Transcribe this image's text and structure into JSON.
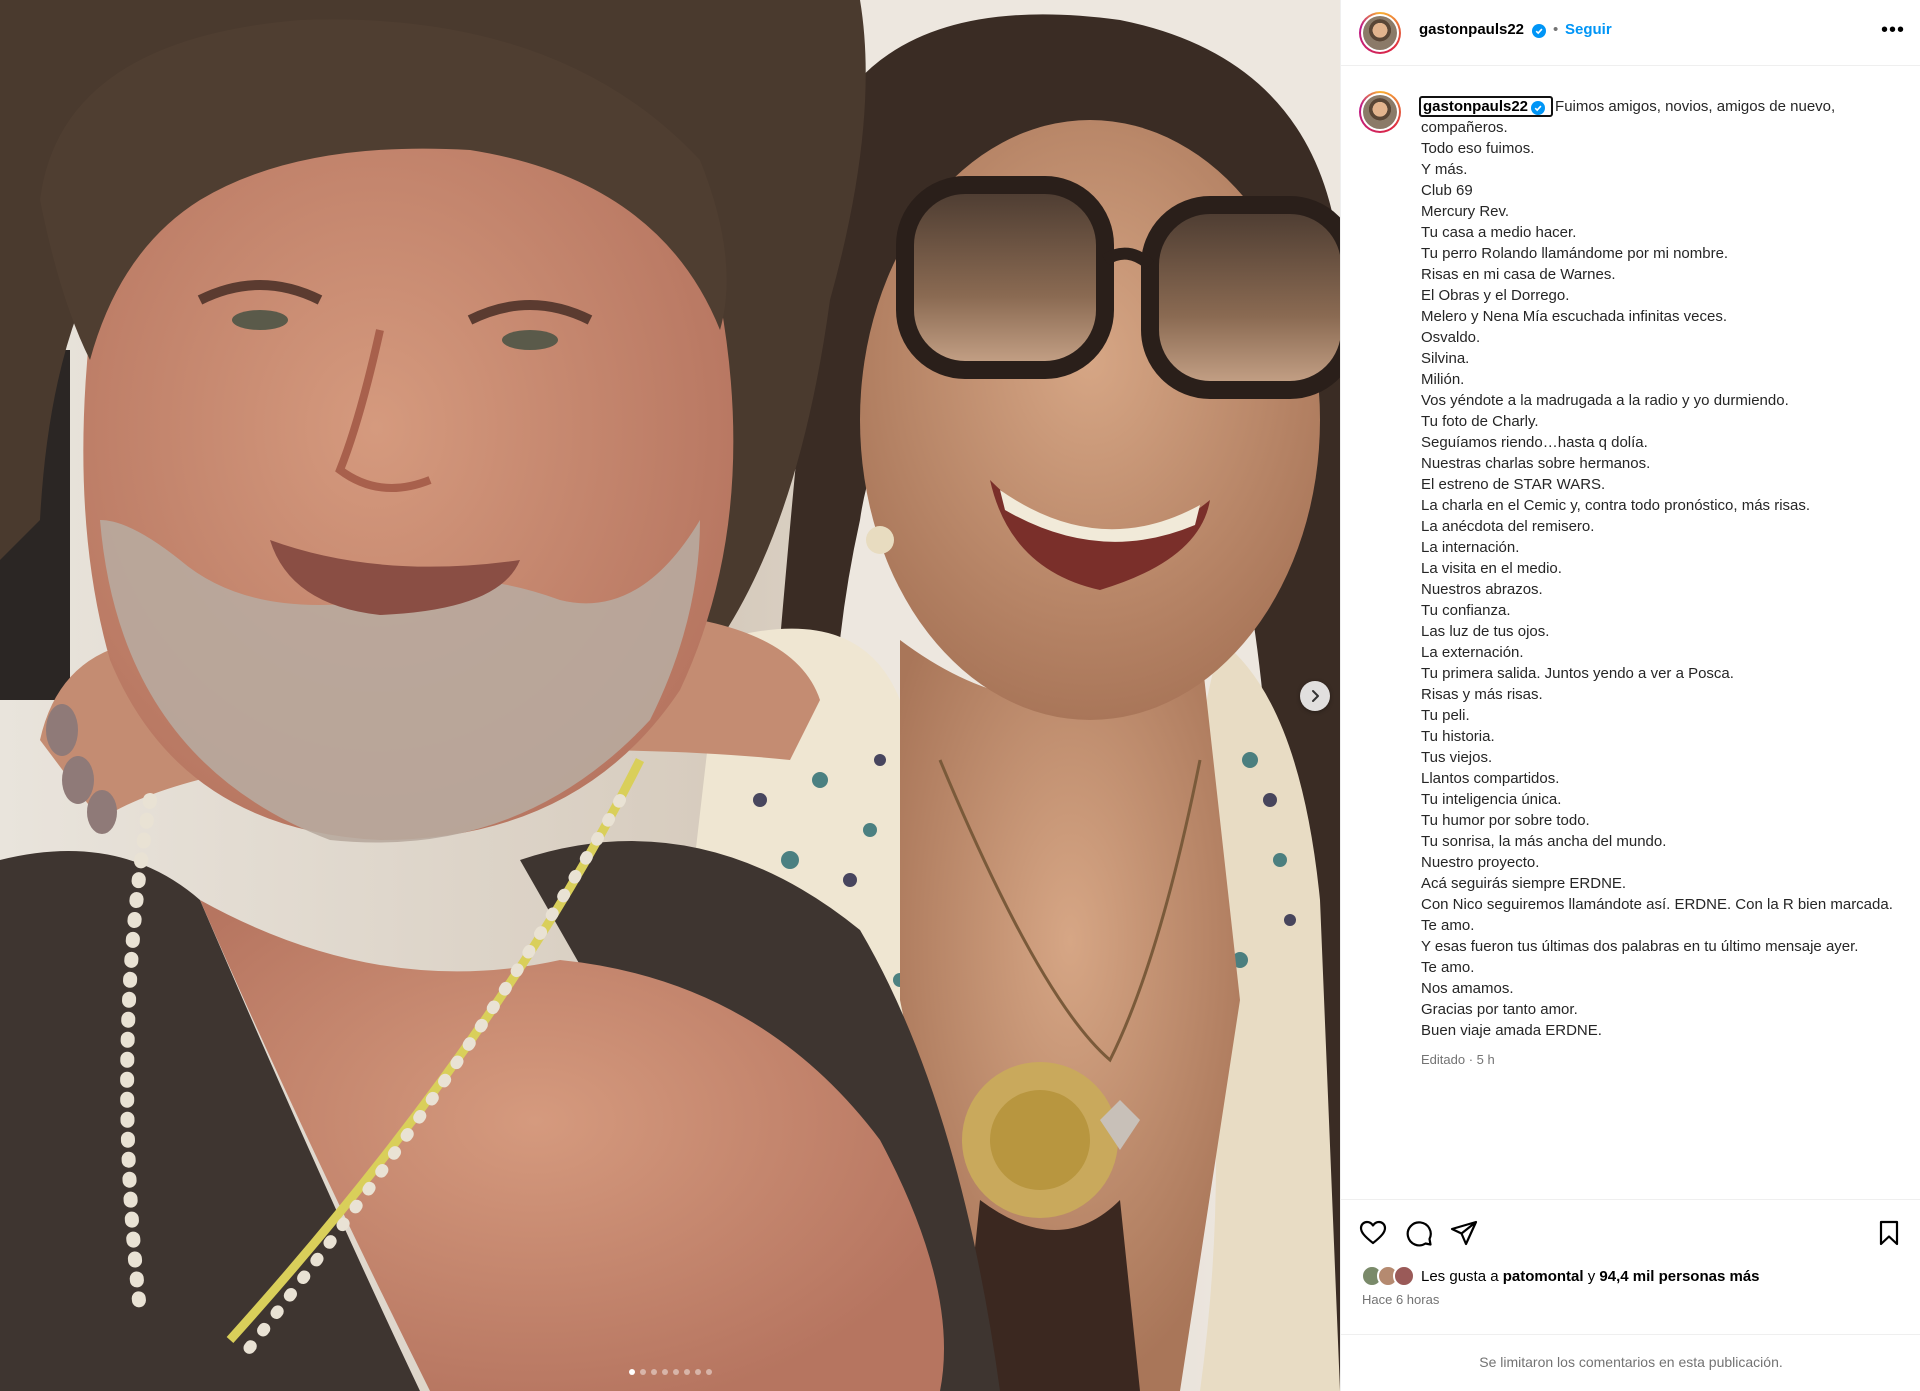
{
  "post": {
    "username": "gastonpauls22",
    "follow_label": "Seguir",
    "bullet": "•",
    "more_label": "•••",
    "caption_intro": "Fuimos amigos, novios, amigos de nuevo, compañeros.",
    "caption_lines": [
      "Todo eso fuimos.",
      "Y más.",
      "Club 69",
      "Mercury Rev.",
      "Tu casa a medio hacer.",
      "Tu perro Rolando llamándome por mi nombre.",
      "Risas en mi casa de Warnes.",
      "El Obras y el Dorrego.",
      "Melero y Nena Mía escuchada infinitas veces.",
      "Osvaldo.",
      "Silvina.",
      "Milión.",
      "Vos yéndote a la madrugada a la radio y yo durmiendo.",
      "Tu foto de Charly.",
      "Seguíamos riendo…hasta q dolía.",
      "Nuestras charlas sobre hermanos.",
      "El estreno de STAR WARS.",
      "La charla en el Cemic y, contra todo pronóstico, más risas.",
      "La anécdota del remisero.",
      "La internación.",
      "La visita en el medio.",
      "Nuestros abrazos.",
      "Tu confianza.",
      "Las luz de tus ojos.",
      "La externación.",
      "Tu primera salida. Juntos yendo a ver a Posca.",
      "Risas y más risas.",
      "Tu peli.",
      "Tu historia.",
      "Tus viejos.",
      "Llantos compartidos.",
      "Tu inteligencia única.",
      "Tu humor por sobre todo.",
      "Tu sonrisa, la más ancha del mundo.",
      "Nuestro proyecto.",
      "Acá seguirás siempre ERDNE.",
      "Con Nico seguiremos llamándote así. ERDNE. Con la R bien marcada.",
      "Te amo.",
      "Y esas fueron tus últimas dos palabras en tu último mensaje ayer.",
      "Te amo.",
      "Nos amamos.",
      "Gracias por tanto amor.",
      "Buen viaje amada ERDNE."
    ],
    "edited_label": "Editado · 5 h",
    "likes_prefix": "Les gusta a ",
    "likes_user": "patomontal",
    "likes_middle": " y ",
    "likes_count": "94,4 mil personas más",
    "time_label": "Hace 6 horas",
    "comments_limited": "Se limitaron los comentarios en esta publicación.",
    "carousel": {
      "total_slides": 8,
      "active_index": 0
    }
  },
  "colors": {
    "accent": "#0095f6",
    "secondary_text": "#737373",
    "border": "#efefef"
  },
  "icons": [
    "verified-badge-icon",
    "more-options-icon",
    "chevron-right-icon",
    "heart-icon",
    "comment-icon",
    "share-icon",
    "bookmark-icon"
  ]
}
